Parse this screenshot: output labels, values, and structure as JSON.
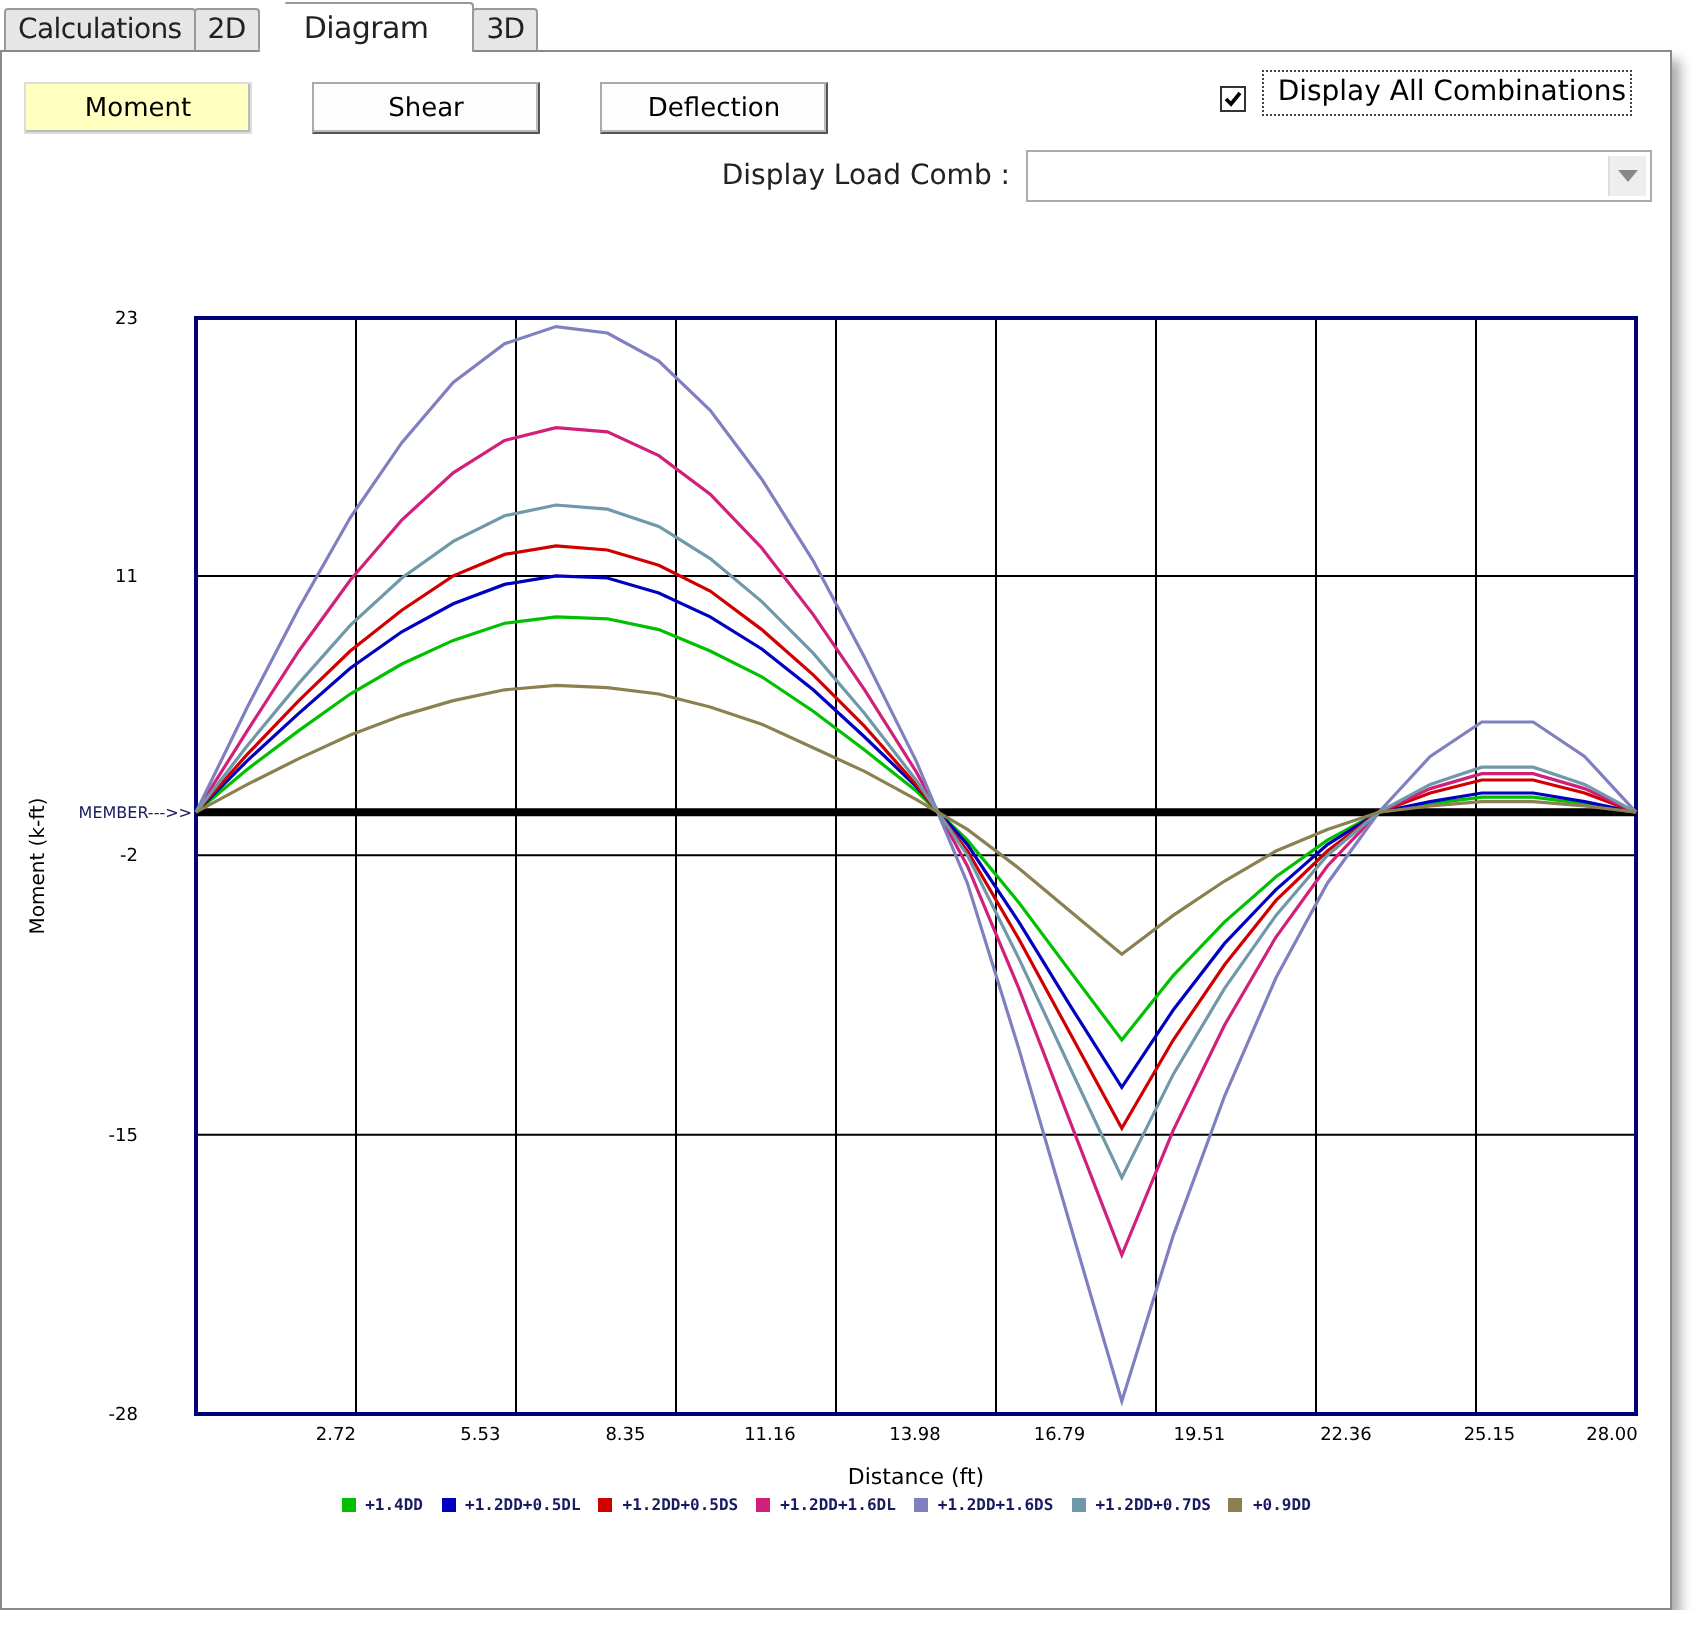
{
  "tabs": [
    {
      "label": "Calculations",
      "selected": false
    },
    {
      "label": "2D",
      "selected": false
    },
    {
      "label": "Diagram",
      "selected": true
    },
    {
      "label": "3D",
      "selected": false
    }
  ],
  "view_buttons": [
    {
      "label": "Moment",
      "selected": true
    },
    {
      "label": "Shear",
      "selected": false
    },
    {
      "label": "Deflection",
      "selected": false
    }
  ],
  "display_all": {
    "label": "Display All Combinations",
    "checked": true
  },
  "load_comb": {
    "label": "Display Load Comb :"
  },
  "chart": {
    "member_label": "MEMBER--->>",
    "chart_data": {
      "type": "line",
      "grid": true,
      "xlabel": "Distance (ft)",
      "ylabel": "Moment (k-ft)",
      "x": [
        0,
        1,
        2,
        3,
        4,
        5,
        6,
        7,
        8,
        9,
        10,
        11,
        12,
        13,
        14,
        15,
        16,
        17,
        18,
        19,
        20,
        21,
        22,
        23,
        24,
        25,
        26,
        27,
        28
      ],
      "series": [
        {
          "name": "+1.4DD",
          "color": "#00c000",
          "values": [
            0,
            2.0,
            3.8,
            5.5,
            6.9,
            8.0,
            8.8,
            9.1,
            9.0,
            8.5,
            7.5,
            6.3,
            4.7,
            2.9,
            1.0,
            -1.3,
            -4.2,
            -7.4,
            -10.6,
            -7.6,
            -5.1,
            -3.0,
            -1.3,
            0,
            0.4,
            0.7,
            0.7,
            0.4,
            0
          ]
        },
        {
          "name": "+1.2DD+0.5DL",
          "color": "#0000c0",
          "values": [
            0,
            2.4,
            4.6,
            6.7,
            8.4,
            9.7,
            10.6,
            11.0,
            10.9,
            10.2,
            9.1,
            7.6,
            5.7,
            3.5,
            1.2,
            -1.5,
            -5.1,
            -9.0,
            -12.8,
            -9.2,
            -6.1,
            -3.6,
            -1.5,
            0,
            0.5,
            0.9,
            0.9,
            0.5,
            0
          ]
        },
        {
          "name": "+1.2DD+0.5DS",
          "color": "#d00000",
          "values": [
            0,
            2.7,
            5.2,
            7.5,
            9.4,
            11.0,
            12.0,
            12.4,
            12.2,
            11.5,
            10.3,
            8.5,
            6.4,
            4.0,
            1.3,
            -1.8,
            -5.9,
            -10.3,
            -14.7,
            -10.6,
            -7.1,
            -4.1,
            -1.8,
            0,
            0.9,
            1.5,
            1.5,
            0.9,
            0
          ]
        },
        {
          "name": "+1.2DD+1.6DL",
          "color": "#d0207a",
          "values": [
            0,
            3.8,
            7.5,
            10.8,
            13.6,
            15.8,
            17.3,
            17.9,
            17.7,
            16.6,
            14.8,
            12.3,
            9.2,
            5.7,
            1.9,
            -2.5,
            -8.2,
            -14.4,
            -20.6,
            -14.8,
            -9.9,
            -5.8,
            -2.5,
            0,
            1.1,
            1.8,
            1.8,
            1.1,
            0
          ]
        },
        {
          "name": "+1.2DD+1.6DS",
          "color": "#8080c0",
          "values": [
            0,
            4.9,
            9.5,
            13.7,
            17.2,
            20.0,
            21.8,
            22.6,
            22.3,
            21.0,
            18.7,
            15.5,
            11.7,
            7.2,
            2.4,
            -3.3,
            -11.0,
            -19.2,
            -27.4,
            -19.7,
            -13.2,
            -7.7,
            -3.3,
            0,
            2.6,
            4.2,
            4.2,
            2.6,
            0
          ]
        },
        {
          "name": "+1.2DD+0.7DS",
          "color": "#6f99a8",
          "values": [
            0,
            3.1,
            6.0,
            8.7,
            10.9,
            12.6,
            13.8,
            14.3,
            14.1,
            13.3,
            11.8,
            9.8,
            7.4,
            4.6,
            1.5,
            -2.0,
            -6.8,
            -11.9,
            -17.0,
            -12.2,
            -8.2,
            -4.8,
            -2.0,
            0,
            1.3,
            2.1,
            2.1,
            1.3,
            0
          ]
        },
        {
          "name": "+0.9DD",
          "color": "#8a8050",
          "values": [
            0,
            1.3,
            2.5,
            3.6,
            4.5,
            5.2,
            5.7,
            5.9,
            5.8,
            5.5,
            4.9,
            4.1,
            3.0,
            1.9,
            0.6,
            -0.8,
            -2.6,
            -4.6,
            -6.6,
            -4.8,
            -3.2,
            -1.8,
            -0.8,
            0,
            0.3,
            0.5,
            0.5,
            0.3,
            0
          ]
        }
      ],
      "xlim": [
        0,
        28
      ],
      "ylim": [
        -28,
        23
      ],
      "xticks": [
        2.72,
        5.53,
        8.35,
        11.16,
        13.98,
        16.79,
        19.51,
        22.36,
        25.15,
        {
          "value": 28,
          "label": "28.00"
        }
      ],
      "yticks": [
        23,
        11,
        -2,
        -15,
        -28
      ]
    }
  }
}
